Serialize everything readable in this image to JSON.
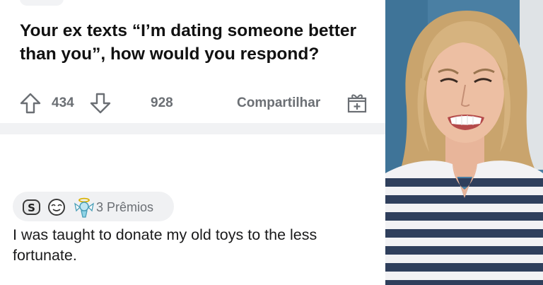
{
  "post": {
    "title": "Your ex texts “I’m dating someone better than you”, how would you respond?",
    "upvotes": "434",
    "comments": "928",
    "share_label": "Compartilhar"
  },
  "comment": {
    "awards_label": "3 Prêmios",
    "text": "I was taught to donate my old toys to the less fortunate."
  },
  "icons": [
    "upvote-arrow",
    "downvote-arrow",
    "gift-award",
    "silver-award",
    "wholesome-face",
    "angel-award"
  ],
  "colors": {
    "text_primary": "#111111",
    "text_muted": "#6b6f74",
    "divider": "#f1f2f4",
    "pill_bg": "#f0f1f3",
    "photo_bg": "#4a7fa3",
    "shirt_stripe": "#2f3f5c",
    "hair": "#d2ae7a"
  }
}
